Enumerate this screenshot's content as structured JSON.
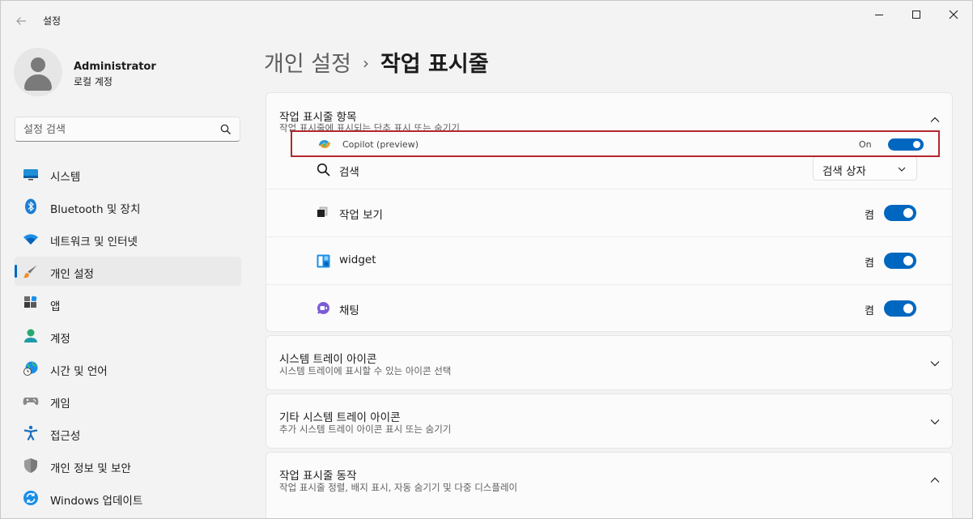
{
  "app": {
    "title": "설정",
    "back_icon": "arrow-left-icon"
  },
  "window_controls": {
    "minimize_icon": "minimize-icon",
    "maximize_icon": "maximize-icon",
    "close_icon": "close-icon"
  },
  "profile": {
    "name": "Administrator",
    "account_type": "로컬 계정"
  },
  "search": {
    "placeholder": "설정 검색",
    "value": ""
  },
  "sidebar": {
    "items": [
      {
        "label": "시스템",
        "icon": "monitor-icon",
        "active": false
      },
      {
        "label": "Bluetooth 및 장치",
        "icon": "bluetooth-icon",
        "active": false
      },
      {
        "label": "네트워크 및 인터넷",
        "icon": "wifi-icon",
        "active": false
      },
      {
        "label": "개인 설정",
        "icon": "brush-icon",
        "active": true
      },
      {
        "label": "앱",
        "icon": "apps-icon",
        "active": false
      },
      {
        "label": "계정",
        "icon": "person-icon",
        "active": false
      },
      {
        "label": "시간 및 언어",
        "icon": "globe-clock-icon",
        "active": false
      },
      {
        "label": "게임",
        "icon": "gamepad-icon",
        "active": false
      },
      {
        "label": "접근성",
        "icon": "accessibility-icon",
        "active": false
      },
      {
        "label": "개인 정보 및 보안",
        "icon": "shield-icon",
        "active": false
      },
      {
        "label": "Windows 업데이트",
        "icon": "sync-icon",
        "active": false
      }
    ]
  },
  "header": {
    "parent": "개인 설정",
    "separator": "›",
    "current": "작업 표시줄"
  },
  "taskbar_items": {
    "title": "작업 표시줄 항목",
    "subtitle": "작업 표시줄에 표시되는 단추 표시 또는 숨기기",
    "copilot": {
      "label": "Copilot (preview)",
      "state_text": "On",
      "on": true
    },
    "search": {
      "label": "검색",
      "dropdown_value": "검색 상자"
    },
    "task_view": {
      "label": "작업 보기",
      "state_text": "켬",
      "on": true
    },
    "widget": {
      "label": "widget",
      "state_text": "켬",
      "on": true
    },
    "chat": {
      "label": "채팅",
      "state_text": "켬",
      "on": true
    }
  },
  "system_tray": {
    "title": "시스템 트레이 아이콘",
    "subtitle": "시스템 트레이에 표시할 수 있는 아이콘 선택"
  },
  "other_tray": {
    "title": "기타 시스템 트레이 아이콘",
    "subtitle": "추가 시스템 트레이 아이콘 표시 또는 숨기기"
  },
  "behavior": {
    "title": "작업 표시줄 동작",
    "subtitle": "작업 표시줄 정렬, 배지 표시, 자동 숨기기 및 다중 디스플레이"
  },
  "colors": {
    "accent": "#0067c0",
    "highlight_border": "#b3282d"
  }
}
